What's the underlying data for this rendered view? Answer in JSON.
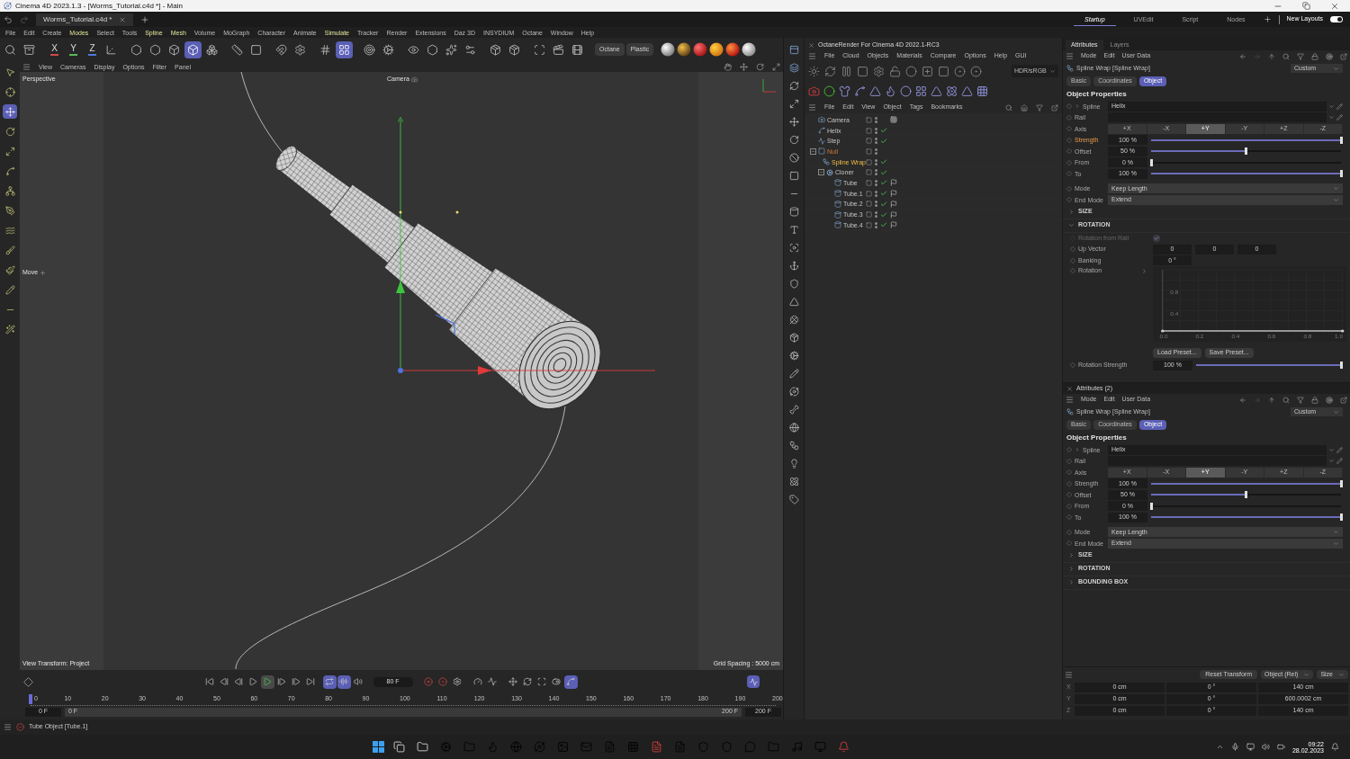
{
  "window": {
    "title": "Cinema 4D 2023.1.3 - [Worms_Tutorial.c4d *] - Main"
  },
  "document_tabs": [
    {
      "label": "Worms_Tutorial.c4d *",
      "selected": true
    }
  ],
  "layouts": [
    {
      "label": "Startup",
      "selected": true
    },
    {
      "label": "UVEdit",
      "selected": false
    },
    {
      "label": "Script",
      "selected": false
    },
    {
      "label": "Nodes",
      "selected": false
    }
  ],
  "new_layouts": {
    "label": "New Layouts",
    "on": true
  },
  "menu": [
    {
      "label": "File",
      "highlighted": false
    },
    {
      "label": "Edit",
      "highlighted": false
    },
    {
      "label": "Create",
      "highlighted": false
    },
    {
      "label": "Modes",
      "highlighted": true
    },
    {
      "label": "Select",
      "highlighted": false
    },
    {
      "label": "Tools",
      "highlighted": false
    },
    {
      "label": "Spline",
      "highlighted": true
    },
    {
      "label": "Mesh",
      "highlighted": true
    },
    {
      "label": "Volume",
      "highlighted": false
    },
    {
      "label": "MoGraph",
      "highlighted": false
    },
    {
      "label": "Character",
      "highlighted": false
    },
    {
      "label": "Animate",
      "highlighted": false
    },
    {
      "label": "Simulate",
      "highlighted": true
    },
    {
      "label": "Tracker",
      "highlighted": false
    },
    {
      "label": "Render",
      "highlighted": false
    },
    {
      "label": "Extensions",
      "highlighted": false
    },
    {
      "label": "Daz 3D",
      "highlighted": false
    },
    {
      "label": "INSYDIUM",
      "highlighted": false
    },
    {
      "label": "Octane",
      "highlighted": false
    },
    {
      "label": "Window",
      "highlighted": false
    },
    {
      "label": "Help",
      "highlighted": false
    }
  ],
  "main_toolbar": [
    {
      "selected": false
    },
    {
      "selected": false
    },
    {
      "label": "X",
      "color": "#d04a4a",
      "selected": false
    },
    {
      "label": "Y",
      "color": "#58b858",
      "selected": false
    },
    {
      "label": "Z",
      "color": "#4a7ad8",
      "selected": false
    },
    {
      "selected": false
    },
    {
      "selected": false
    },
    {
      "selected": false
    },
    {
      "selected": false
    },
    {
      "selected": true
    },
    {
      "selected": false
    },
    {
      "selected": false
    },
    {
      "selected": false
    },
    {
      "selected": false
    },
    {
      "selected": false
    },
    {
      "selected": false
    },
    {
      "selected": true
    },
    {
      "selected": false
    },
    {
      "selected": false
    },
    {
      "selected": false
    },
    {
      "selected": false
    },
    {
      "selected": false
    },
    {
      "selected": false
    },
    {
      "selected": false
    },
    {
      "selected": false
    },
    {
      "selected": false
    },
    {
      "selected": false
    },
    {
      "selected": false
    }
  ],
  "render_chips": [
    "Octane",
    "Plastic"
  ],
  "left_toolbar": [
    {
      "selected": false
    },
    {
      "selected": false
    },
    {
      "selected": true
    },
    {
      "selected": false
    },
    {
      "selected": false
    },
    {
      "selected": false
    },
    {
      "selected": false
    },
    {
      "selected": false
    },
    {
      "selected": false
    },
    {
      "selected": false
    },
    {
      "selected": false
    },
    {
      "selected": false
    },
    {
      "selected": false
    },
    {
      "selected": false
    }
  ],
  "viewport": {
    "menu": [
      "View",
      "Cameras",
      "Display",
      "Options",
      "Filter",
      "Panel"
    ],
    "label": "Perspective",
    "camera": "Camera",
    "tool": "Move",
    "view_transform": "View Transform: Project",
    "grid_spacing": "Grid Spacing : 5000 cm"
  },
  "octane": {
    "title": "OctaneRender For Cinema 4D 2022.1-RC3",
    "menu": [
      "File",
      "Cloud",
      "Objects",
      "Materials",
      "Compare",
      "Options",
      "Help",
      "GUI"
    ],
    "color_space": "HDR/sRGB"
  },
  "object_manager": {
    "menu": [
      "File",
      "Edit",
      "View",
      "Object",
      "Tags",
      "Bookmarks"
    ],
    "objects": [
      {
        "name": "Camera",
        "kind": "camera",
        "selected": false,
        "highlighted": false,
        "checked": false,
        "tags": [
          {
            "kind": "target"
          }
        ]
      },
      {
        "name": "Helix",
        "kind": "spline",
        "selected": false,
        "highlighted": false,
        "checked": true
      },
      {
        "name": "Step",
        "kind": "step",
        "selected": false,
        "highlighted": false,
        "checked": true
      },
      {
        "name": "Null",
        "kind": "null",
        "selected": false,
        "highlighted": true,
        "checked": false,
        "expanded": true,
        "children": [
          {
            "name": "Spline Wrap",
            "kind": "deformer",
            "selected": true,
            "highlighted": false,
            "checked": true
          },
          {
            "name": "Cloner",
            "kind": "cloner",
            "selected": false,
            "highlighted": false,
            "checked": true,
            "expanded": true,
            "children": [
              {
                "name": "Tube",
                "kind": "tube",
                "selected": false,
                "highlighted": false,
                "checked": true,
                "tags": [
                  {
                    "kind": "material"
                  }
                ]
              },
              {
                "name": "Tube.1",
                "kind": "tube",
                "selected": false,
                "highlighted": false,
                "checked": true,
                "tags": [
                  {
                    "kind": "material"
                  }
                ]
              },
              {
                "name": "Tube.2",
                "kind": "tube",
                "selected": false,
                "highlighted": false,
                "checked": true,
                "tags": [
                  {
                    "kind": "material"
                  }
                ]
              },
              {
                "name": "Tube.3",
                "kind": "tube",
                "selected": false,
                "highlighted": false,
                "checked": true,
                "tags": [
                  {
                    "kind": "material"
                  }
                ]
              },
              {
                "name": "Tube.4",
                "kind": "tube",
                "selected": false,
                "highlighted": false,
                "checked": true,
                "tags": [
                  {
                    "kind": "material"
                  }
                ]
              }
            ]
          }
        ]
      }
    ]
  },
  "attribute_panels": [
    {
      "header_tabs": [
        {
          "label": "Attributes",
          "selected": true
        },
        {
          "label": "Layers",
          "selected": false
        }
      ],
      "menu": [
        "Mode",
        "Edit",
        "User Data"
      ],
      "object": "Spline Wrap [Spline Wrap]",
      "preset": "Custom",
      "page_tabs": [
        {
          "label": "Basic",
          "selected": false
        },
        {
          "label": "Coordinates",
          "selected": false
        },
        {
          "label": "Object",
          "selected": true
        }
      ],
      "section": "Object Properties",
      "rows": [
        {
          "kind": "link",
          "label": "Spline",
          "value": "Helix",
          "expandable": true,
          "highlighted": false
        },
        {
          "kind": "link",
          "label": "Rail",
          "highlighted": false
        },
        {
          "kind": "axis",
          "label": "Axis",
          "highlighted": false,
          "options": [
            {
              "label": "+X",
              "selected": false
            },
            {
              "label": "-X",
              "selected": false
            },
            {
              "label": "+Y",
              "selected": true
            },
            {
              "label": "-Y",
              "selected": false
            },
            {
              "label": "+Z",
              "selected": false
            },
            {
              "label": "-Z",
              "selected": false
            }
          ]
        },
        {
          "kind": "slider",
          "label": "Strength",
          "value": "100 %",
          "level": 1,
          "highlighted": true
        },
        {
          "kind": "slider",
          "label": "Offset",
          "value": "50 %",
          "level": 0.5,
          "highlighted": false
        },
        {
          "kind": "slider",
          "label": "From",
          "value": "0 %",
          "level": 0,
          "highlighted": false
        },
        {
          "kind": "slider",
          "label": "To",
          "value": "100 %",
          "level": 1,
          "highlighted": false
        },
        {
          "kind": "dropdown",
          "label": "Mode",
          "value": "Keep Length",
          "highlighted": false
        },
        {
          "kind": "dropdown",
          "label": "End Mode",
          "value": "Extend",
          "highlighted": false
        }
      ],
      "groups": [
        {
          "label": "SIZE",
          "expanded": false
        },
        {
          "label": "ROTATION",
          "expanded": true,
          "rows": [
            {
              "kind": "checkbox",
              "label": "Rotation from Rail",
              "checked": true,
              "disabled": true
            },
            {
              "kind": "vector",
              "label": "Up Vector",
              "values": [
                "0",
                "0",
                "0"
              ]
            },
            {
              "kind": "number",
              "label": "Banking",
              "value": "0 °"
            },
            {
              "kind": "graph",
              "label": "Rotation",
              "x_labels": [
                "0.0",
                "0.2",
                "0.4",
                "0.6",
                "0.8",
                "1.0"
              ],
              "y_labels": [
                "0.8",
                "0.4"
              ]
            },
            {
              "kind": "presets",
              "buttons": [
                "Load Preset...",
                "Save Preset..."
              ]
            },
            {
              "kind": "slider",
              "label": "Rotation Strength",
              "value": "100 %",
              "level": 1,
              "highlighted": false
            }
          ]
        }
      ]
    },
    {
      "title": "Attributes (2)",
      "menu": [
        "Mode",
        "Edit",
        "User Data"
      ],
      "object": "Spline Wrap [Spline Wrap]",
      "preset": "Custom",
      "page_tabs": [
        {
          "label": "Basic",
          "selected": false
        },
        {
          "label": "Coordinates",
          "selected": false
        },
        {
          "label": "Object",
          "selected": true
        }
      ],
      "section": "Object Properties",
      "rows": [
        {
          "kind": "link",
          "label": "Spline",
          "value": "Helix",
          "expandable": true,
          "highlighted": false
        },
        {
          "kind": "link",
          "label": "Rail",
          "highlighted": false
        },
        {
          "kind": "axis",
          "label": "Axis",
          "highlighted": false,
          "options": [
            {
              "label": "+X",
              "selected": false
            },
            {
              "label": "-X",
              "selected": false
            },
            {
              "label": "+Y",
              "selected": true
            },
            {
              "label": "-Y",
              "selected": false
            },
            {
              "label": "+Z",
              "selected": false
            },
            {
              "label": "-Z",
              "selected": false
            }
          ]
        },
        {
          "kind": "slider",
          "label": "Strength",
          "value": "100 %",
          "level": 1,
          "highlighted": false
        },
        {
          "kind": "slider",
          "label": "Offset",
          "value": "50 %",
          "level": 0.5,
          "highlighted": false
        },
        {
          "kind": "slider",
          "label": "From",
          "value": "0 %",
          "level": 0,
          "highlighted": false
        },
        {
          "kind": "slider",
          "label": "To",
          "value": "100 %",
          "level": 1,
          "highlighted": false
        },
        {
          "kind": "dropdown",
          "label": "Mode",
          "value": "Keep Length",
          "highlighted": false
        },
        {
          "kind": "dropdown",
          "label": "End Mode",
          "value": "Extend",
          "highlighted": false
        }
      ],
      "groups": [
        {
          "label": "SIZE",
          "expanded": false
        },
        {
          "label": "ROTATION",
          "expanded": false
        },
        {
          "label": "BOUNDING BOX",
          "expanded": false
        }
      ]
    }
  ],
  "coordinates": {
    "button": "Reset Transform",
    "dropdowns": [
      "Object (Rel)",
      "Size"
    ],
    "rows": [
      {
        "axis": "X",
        "values": [
          "0 cm",
          "0 °",
          "140 cm"
        ]
      },
      {
        "axis": "Y",
        "values": [
          "0 cm",
          "0 °",
          "600.0002 cm"
        ]
      },
      {
        "axis": "Z",
        "values": [
          "0 cm",
          "0 °",
          "140 cm"
        ]
      }
    ]
  },
  "timeline": {
    "buttons": [
      {
        "selected": false
      },
      {
        "selected": false
      },
      {
        "selected": false
      },
      {
        "selected": false
      },
      {
        "selected": true
      },
      {
        "selected": false
      },
      {
        "selected": false
      },
      {
        "selected": false
      },
      {
        "selected": true
      },
      {
        "selected": true
      },
      {
        "selected": false
      }
    ],
    "frame": "80 F",
    "tools": [
      {
        "selected": false
      },
      {
        "selected": false
      },
      {
        "selected": false
      },
      {
        "selected": false
      },
      {
        "selected": false
      },
      {
        "selected": false
      },
      {
        "selected": false
      },
      {
        "selected": false
      },
      {
        "selected": false
      },
      {
        "selected": true
      }
    ],
    "ruler": [
      "0",
      "10",
      "20",
      "30",
      "40",
      "50",
      "60",
      "70",
      "80",
      "90",
      "100",
      "110",
      "120",
      "130",
      "140",
      "150",
      "160",
      "170",
      "180",
      "190",
      "200"
    ],
    "playhead": {
      "level": 0
    },
    "start_field": "0 F",
    "range_start": "0 F",
    "range_end": "200 F",
    "end_field": "200 F"
  },
  "status_bar": {
    "text": "Tube Object [Tube.1]"
  },
  "taskbar": {
    "time": "09:22",
    "date": "28.02.2023"
  }
}
